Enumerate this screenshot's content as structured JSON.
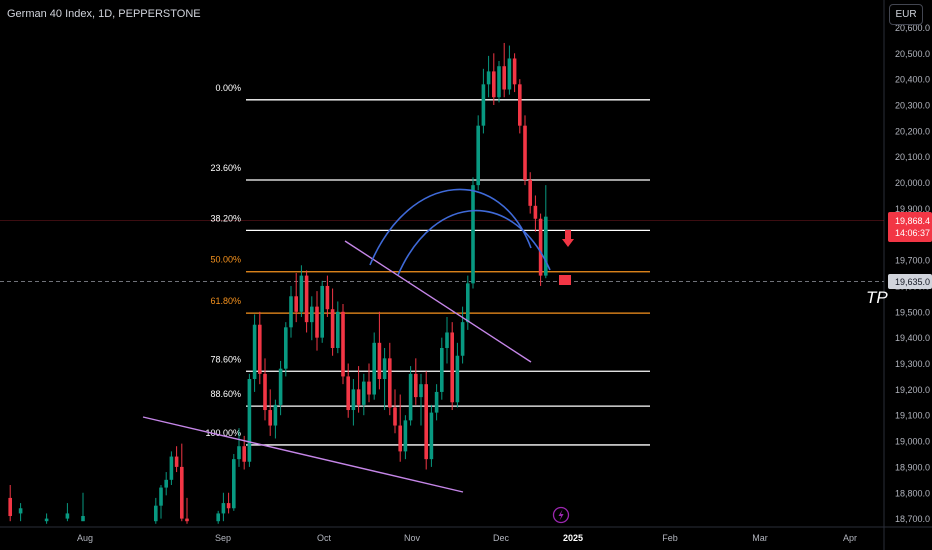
{
  "header": {
    "title": "German 40 Index, 1D, PEPPERSTONE",
    "currency": "EUR"
  },
  "price_badge": {
    "price": "19,868.4",
    "timer": "14:06:37",
    "color": "#f23645"
  },
  "crosshair_label": "19,635.0",
  "annotation_tp": "TP",
  "colors": {
    "bull": "#089981",
    "bear": "#f23645",
    "fib_white": "#ffffff",
    "fib_orange": "#f7931e",
    "trendline": "#c586e8",
    "arc": "#3f6ad8",
    "axis_text": "#b2b5be"
  },
  "chart_data": {
    "type": "candlestick",
    "title": "German 40 Index, 1D, PEPPERSTONE",
    "ylim": [
      18680,
      20640
    ],
    "y_ticks": [
      "18,700.0",
      "18,800.0",
      "18,900.0",
      "19,000.0",
      "19,100.0",
      "19,200.0",
      "19,300.0",
      "19,400.0",
      "19,500.0",
      "19,600.0",
      "19,700.0",
      "19,800.0",
      "19,900.0",
      "20,000.0",
      "20,100.0",
      "20,200.0",
      "20,300.0",
      "20,400.0",
      "20,500.0",
      "20,600.0"
    ],
    "x_ticks": [
      "Aug",
      "Sep",
      "Oct",
      "Nov",
      "Dec",
      "2025",
      "Feb",
      "Mar",
      "Apr"
    ],
    "fib_levels": [
      {
        "label": "0.00%",
        "price": 20320,
        "color": "white"
      },
      {
        "label": "23.60%",
        "price": 20010,
        "color": "white"
      },
      {
        "label": "38.20%",
        "price": 19815,
        "color": "white"
      },
      {
        "label": "50.00%",
        "price": 19655,
        "color": "orange"
      },
      {
        "label": "61.80%",
        "price": 19495,
        "color": "orange"
      },
      {
        "label": "78.60%",
        "price": 19270,
        "color": "white"
      },
      {
        "label": "88.60%",
        "price": 19135,
        "color": "white"
      },
      {
        "label": "100.00%",
        "price": 18985,
        "color": "white"
      }
    ],
    "candles": [
      {
        "x": 1,
        "o": 18780,
        "h": 18830,
        "l": 18690,
        "c": 18710
      },
      {
        "x": 3,
        "o": 18720,
        "h": 18760,
        "l": 18690,
        "c": 18740
      },
      {
        "x": 8,
        "o": 18690,
        "h": 18720,
        "l": 18680,
        "c": 18700
      },
      {
        "x": 12,
        "o": 18700,
        "h": 18760,
        "l": 18690,
        "c": 18720
      },
      {
        "x": 15,
        "o": 18690,
        "h": 18800,
        "l": 18690,
        "c": 18710
      },
      {
        "x": 29,
        "o": 18690,
        "h": 18780,
        "l": 18680,
        "c": 18750
      },
      {
        "x": 30,
        "o": 18750,
        "h": 18830,
        "l": 18700,
        "c": 18820
      },
      {
        "x": 31,
        "o": 18820,
        "h": 18880,
        "l": 18790,
        "c": 18850
      },
      {
        "x": 32,
        "o": 18850,
        "h": 18960,
        "l": 18830,
        "c": 18940
      },
      {
        "x": 33,
        "o": 18940,
        "h": 18980,
        "l": 18880,
        "c": 18900
      },
      {
        "x": 34,
        "o": 18900,
        "h": 18990,
        "l": 18690,
        "c": 18700
      },
      {
        "x": 35,
        "o": 18700,
        "h": 18780,
        "l": 18680,
        "c": 18690
      },
      {
        "x": 41,
        "o": 18690,
        "h": 18730,
        "l": 18680,
        "c": 18720
      },
      {
        "x": 42,
        "o": 18720,
        "h": 18800,
        "l": 18690,
        "c": 18760
      },
      {
        "x": 43,
        "o": 18760,
        "h": 18800,
        "l": 18720,
        "c": 18740
      },
      {
        "x": 44,
        "o": 18740,
        "h": 18950,
        "l": 18730,
        "c": 18930
      },
      {
        "x": 45,
        "o": 18930,
        "h": 19050,
        "l": 18900,
        "c": 18980
      },
      {
        "x": 46,
        "o": 18980,
        "h": 19020,
        "l": 18890,
        "c": 18920
      },
      {
        "x": 47,
        "o": 18920,
        "h": 19260,
        "l": 18900,
        "c": 19240
      },
      {
        "x": 48,
        "o": 19240,
        "h": 19490,
        "l": 19190,
        "c": 19450
      },
      {
        "x": 49,
        "o": 19450,
        "h": 19500,
        "l": 19220,
        "c": 19260
      },
      {
        "x": 50,
        "o": 19260,
        "h": 19320,
        "l": 19080,
        "c": 19120
      },
      {
        "x": 51,
        "o": 19120,
        "h": 19200,
        "l": 19020,
        "c": 19060
      },
      {
        "x": 52,
        "o": 19060,
        "h": 19160,
        "l": 19010,
        "c": 19140
      },
      {
        "x": 53,
        "o": 19140,
        "h": 19310,
        "l": 19100,
        "c": 19280
      },
      {
        "x": 54,
        "o": 19280,
        "h": 19460,
        "l": 19250,
        "c": 19440
      },
      {
        "x": 55,
        "o": 19440,
        "h": 19600,
        "l": 19400,
        "c": 19560
      },
      {
        "x": 56,
        "o": 19560,
        "h": 19650,
        "l": 19460,
        "c": 19500
      },
      {
        "x": 57,
        "o": 19500,
        "h": 19680,
        "l": 19480,
        "c": 19640
      },
      {
        "x": 58,
        "o": 19640,
        "h": 19660,
        "l": 19420,
        "c": 19460
      },
      {
        "x": 59,
        "o": 19460,
        "h": 19560,
        "l": 19390,
        "c": 19520
      },
      {
        "x": 60,
        "o": 19520,
        "h": 19580,
        "l": 19350,
        "c": 19400
      },
      {
        "x": 61,
        "o": 19400,
        "h": 19620,
        "l": 19380,
        "c": 19600
      },
      {
        "x": 62,
        "o": 19600,
        "h": 19640,
        "l": 19480,
        "c": 19510
      },
      {
        "x": 63,
        "o": 19510,
        "h": 19590,
        "l": 19330,
        "c": 19360
      },
      {
        "x": 64,
        "o": 19360,
        "h": 19540,
        "l": 19340,
        "c": 19500
      },
      {
        "x": 65,
        "o": 19500,
        "h": 19530,
        "l": 19220,
        "c": 19250
      },
      {
        "x": 66,
        "o": 19250,
        "h": 19300,
        "l": 19090,
        "c": 19120
      },
      {
        "x": 67,
        "o": 19120,
        "h": 19240,
        "l": 19060,
        "c": 19200
      },
      {
        "x": 68,
        "o": 19200,
        "h": 19290,
        "l": 19110,
        "c": 19140
      },
      {
        "x": 69,
        "o": 19140,
        "h": 19260,
        "l": 19100,
        "c": 19230
      },
      {
        "x": 70,
        "o": 19230,
        "h": 19300,
        "l": 19150,
        "c": 19180
      },
      {
        "x": 71,
        "o": 19180,
        "h": 19420,
        "l": 19160,
        "c": 19380
      },
      {
        "x": 72,
        "o": 19380,
        "h": 19500,
        "l": 19200,
        "c": 19240
      },
      {
        "x": 73,
        "o": 19240,
        "h": 19360,
        "l": 19120,
        "c": 19320
      },
      {
        "x": 74,
        "o": 19320,
        "h": 19380,
        "l": 19100,
        "c": 19130
      },
      {
        "x": 75,
        "o": 19130,
        "h": 19200,
        "l": 19030,
        "c": 19060
      },
      {
        "x": 76,
        "o": 19060,
        "h": 19180,
        "l": 18920,
        "c": 18960
      },
      {
        "x": 77,
        "o": 18960,
        "h": 19100,
        "l": 18930,
        "c": 19080
      },
      {
        "x": 78,
        "o": 19080,
        "h": 19290,
        "l": 19060,
        "c": 19260
      },
      {
        "x": 79,
        "o": 19260,
        "h": 19320,
        "l": 19140,
        "c": 19170
      },
      {
        "x": 80,
        "o": 19170,
        "h": 19260,
        "l": 19060,
        "c": 19220
      },
      {
        "x": 81,
        "o": 19220,
        "h": 19270,
        "l": 18890,
        "c": 18930
      },
      {
        "x": 82,
        "o": 18930,
        "h": 19140,
        "l": 18900,
        "c": 19110
      },
      {
        "x": 83,
        "o": 19110,
        "h": 19220,
        "l": 19080,
        "c": 19190
      },
      {
        "x": 84,
        "o": 19190,
        "h": 19400,
        "l": 19160,
        "c": 19360
      },
      {
        "x": 85,
        "o": 19360,
        "h": 19480,
        "l": 19300,
        "c": 19420
      },
      {
        "x": 86,
        "o": 19420,
        "h": 19460,
        "l": 19120,
        "c": 19150
      },
      {
        "x": 87,
        "o": 19150,
        "h": 19380,
        "l": 19130,
        "c": 19330
      },
      {
        "x": 88,
        "o": 19330,
        "h": 19520,
        "l": 19300,
        "c": 19460
      },
      {
        "x": 89,
        "o": 19460,
        "h": 19640,
        "l": 19430,
        "c": 19610
      },
      {
        "x": 90,
        "o": 19610,
        "h": 20020,
        "l": 19590,
        "c": 19990
      },
      {
        "x": 91,
        "o": 19990,
        "h": 20260,
        "l": 19970,
        "c": 20220
      },
      {
        "x": 92,
        "o": 20220,
        "h": 20440,
        "l": 20190,
        "c": 20380
      },
      {
        "x": 93,
        "o": 20380,
        "h": 20490,
        "l": 20330,
        "c": 20430
      },
      {
        "x": 94,
        "o": 20430,
        "h": 20500,
        "l": 20300,
        "c": 20330
      },
      {
        "x": 95,
        "o": 20330,
        "h": 20470,
        "l": 20310,
        "c": 20450
      },
      {
        "x": 96,
        "o": 20450,
        "h": 20540,
        "l": 20330,
        "c": 20360
      },
      {
        "x": 97,
        "o": 20360,
        "h": 20530,
        "l": 20340,
        "c": 20480
      },
      {
        "x": 98,
        "o": 20480,
        "h": 20500,
        "l": 20350,
        "c": 20380
      },
      {
        "x": 99,
        "o": 20380,
        "h": 20400,
        "l": 20190,
        "c": 20220
      },
      {
        "x": 100,
        "o": 20220,
        "h": 20260,
        "l": 19990,
        "c": 20010
      },
      {
        "x": 101,
        "o": 20010,
        "h": 20040,
        "l": 19880,
        "c": 19910
      },
      {
        "x": 102,
        "o": 19910,
        "h": 19950,
        "l": 19810,
        "c": 19860
      },
      {
        "x": 103,
        "o": 19860,
        "h": 19880,
        "l": 19600,
        "c": 19640
      },
      {
        "x": 104,
        "o": 19640,
        "h": 19990,
        "l": 19630,
        "c": 19868
      }
    ]
  }
}
